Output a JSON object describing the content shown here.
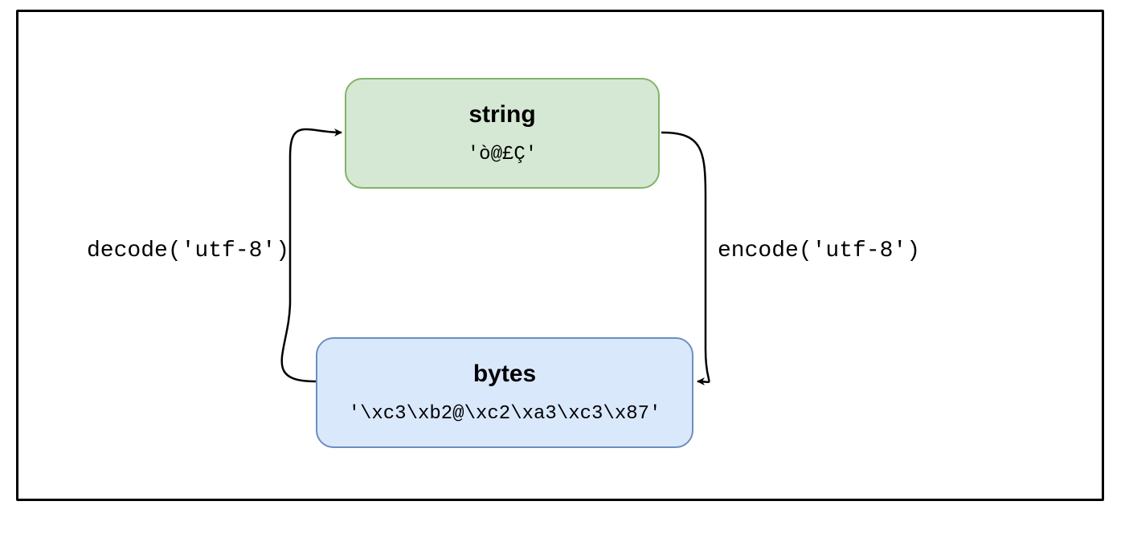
{
  "nodes": {
    "string": {
      "title": "string",
      "value": "'ò@£Ç'"
    },
    "bytes": {
      "title": "bytes",
      "value": "'\\xc3\\xb2@\\xc2\\xa3\\xc3\\x87'"
    }
  },
  "edges": {
    "decode": {
      "label": "decode('utf-8')"
    },
    "encode": {
      "label": "encode('utf-8')"
    }
  }
}
